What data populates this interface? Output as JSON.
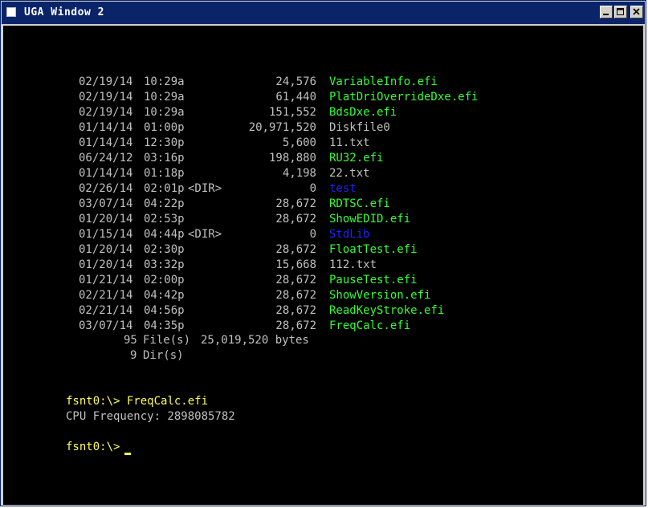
{
  "window": {
    "title": "UGA Window 2",
    "minimize_label": "_",
    "maximize_label": "□",
    "close_label": "×"
  },
  "colors": {
    "efi_file": "#30ff30",
    "directory": "#2020ff",
    "plain_file": "#c0c0c0",
    "prompt": "#ffff50",
    "background": "#000000"
  },
  "listing": [
    {
      "date": "02/19/14",
      "time": "10:29a",
      "dir": "",
      "size": "24,576",
      "name": "VariableInfo.efi",
      "kind": "efi_file"
    },
    {
      "date": "02/19/14",
      "time": "10:29a",
      "dir": "",
      "size": "61,440",
      "name": "PlatDriOverrideDxe.efi",
      "kind": "efi_file"
    },
    {
      "date": "02/19/14",
      "time": "10:29a",
      "dir": "",
      "size": "151,552",
      "name": "BdsDxe.efi",
      "kind": "efi_file"
    },
    {
      "date": "01/14/14",
      "time": "01:00p",
      "dir": "",
      "size": "20,971,520",
      "name": "Diskfile0",
      "kind": "plain_file"
    },
    {
      "date": "01/14/14",
      "time": "12:30p",
      "dir": "",
      "size": "5,600",
      "name": "11.txt",
      "kind": "plain_file"
    },
    {
      "date": "06/24/12",
      "time": "03:16p",
      "dir": "",
      "size": "198,880",
      "name": "RU32.efi",
      "kind": "efi_file"
    },
    {
      "date": "01/14/14",
      "time": "01:18p",
      "dir": "",
      "size": "4,198",
      "name": "22.txt",
      "kind": "plain_file"
    },
    {
      "date": "02/26/14",
      "time": "02:01p",
      "dir": "<DIR>",
      "size": "0",
      "name": "test",
      "kind": "directory"
    },
    {
      "date": "03/07/14",
      "time": "04:22p",
      "dir": "",
      "size": "28,672",
      "name": "RDTSC.efi",
      "kind": "efi_file"
    },
    {
      "date": "01/20/14",
      "time": "02:53p",
      "dir": "",
      "size": "28,672",
      "name": "ShowEDID.efi",
      "kind": "efi_file"
    },
    {
      "date": "01/15/14",
      "time": "04:44p",
      "dir": "<DIR>",
      "size": "0",
      "name": "StdLib",
      "kind": "directory"
    },
    {
      "date": "01/20/14",
      "time": "02:30p",
      "dir": "",
      "size": "28,672",
      "name": "FloatTest.efi",
      "kind": "efi_file"
    },
    {
      "date": "01/20/14",
      "time": "03:32p",
      "dir": "",
      "size": "15,668",
      "name": "112.txt",
      "kind": "plain_file"
    },
    {
      "date": "01/21/14",
      "time": "02:00p",
      "dir": "",
      "size": "28,672",
      "name": "PauseTest.efi",
      "kind": "efi_file"
    },
    {
      "date": "02/21/14",
      "time": "04:42p",
      "dir": "",
      "size": "28,672",
      "name": "ShowVersion.efi",
      "kind": "efi_file"
    },
    {
      "date": "02/21/14",
      "time": "04:56p",
      "dir": "",
      "size": "28,672",
      "name": "ReadKeyStroke.efi",
      "kind": "efi_file"
    },
    {
      "date": "03/07/14",
      "time": "04:35p",
      "dir": "",
      "size": "28,672",
      "name": "FreqCalc.efi",
      "kind": "efi_file"
    }
  ],
  "summary": {
    "file_count": "95",
    "file_label": "File(s)",
    "total_bytes": "25,019,520 bytes",
    "dir_count": "9",
    "dir_label": "Dir(s)"
  },
  "session": {
    "command_line": "fsnt0:\\> FreqCalc.efi",
    "output_line": "CPU Frequency: 2898085782",
    "current_prompt": "fsnt0:\\> "
  }
}
